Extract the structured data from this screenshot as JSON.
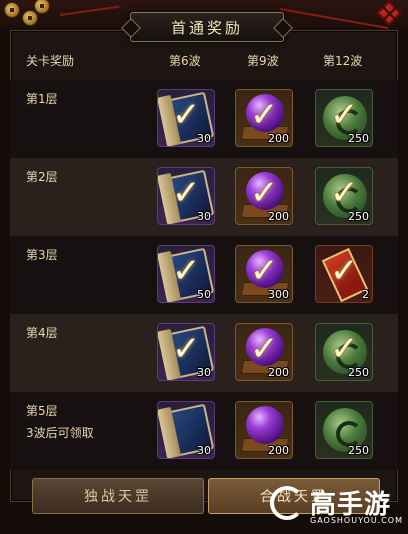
{
  "title": "首通奖励",
  "columns": {
    "label": "关卡奖励",
    "wave1": "第6波",
    "wave2": "第9波",
    "wave3": "第12波"
  },
  "rows": [
    {
      "floor": "第1层",
      "note": "",
      "rewards": [
        {
          "icon": "skill-book-icon",
          "qty": "30",
          "claimed": true
        },
        {
          "icon": "purple-orb-icon",
          "qty": "200",
          "claimed": true
        },
        {
          "icon": "jade-icon",
          "qty": "250",
          "claimed": true
        }
      ]
    },
    {
      "floor": "第2层",
      "note": "",
      "rewards": [
        {
          "icon": "skill-book-icon",
          "qty": "30",
          "claimed": true
        },
        {
          "icon": "purple-orb-icon",
          "qty": "200",
          "claimed": true
        },
        {
          "icon": "jade-icon",
          "qty": "250",
          "claimed": true
        }
      ]
    },
    {
      "floor": "第3层",
      "note": "",
      "rewards": [
        {
          "icon": "skill-book-icon",
          "qty": "50",
          "claimed": true
        },
        {
          "icon": "purple-orb-icon",
          "qty": "300",
          "claimed": true
        },
        {
          "icon": "red-scroll-icon",
          "qty": "2",
          "claimed": true
        }
      ]
    },
    {
      "floor": "第4层",
      "note": "",
      "rewards": [
        {
          "icon": "skill-book-icon",
          "qty": "30",
          "claimed": true
        },
        {
          "icon": "purple-orb-icon",
          "qty": "200",
          "claimed": true
        },
        {
          "icon": "jade-icon",
          "qty": "250",
          "claimed": true
        }
      ]
    },
    {
      "floor": "第5层",
      "note": "3波后可领取",
      "rewards": [
        {
          "icon": "skill-book-icon",
          "qty": "30",
          "claimed": false
        },
        {
          "icon": "purple-orb-icon",
          "qty": "200",
          "claimed": false
        },
        {
          "icon": "jade-icon",
          "qty": "250",
          "claimed": false
        }
      ]
    }
  ],
  "buttons": {
    "solo": "独战天罡",
    "team": "合战天罡"
  },
  "watermark": {
    "brand": "高手游",
    "url": "GAOSHOUYOU.COM"
  },
  "check_glyph": "✓"
}
